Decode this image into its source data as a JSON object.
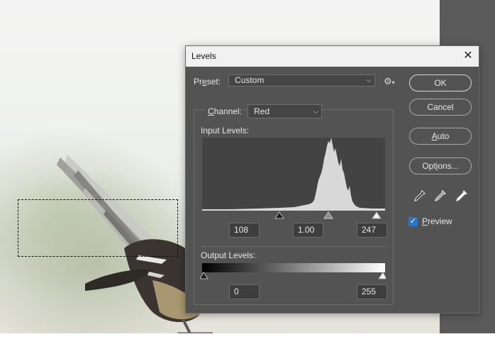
{
  "dialog": {
    "title": "Levels",
    "close_glyph": "✕",
    "preset_label_pre": "Pr",
    "preset_label_u": "e",
    "preset_label_post": "set:",
    "preset_value": "Custom",
    "channel_label_u": "C",
    "channel_label_post": "hannel:",
    "channel_value": "Red",
    "input_levels_label": "Input Levels:",
    "output_levels_label": "Output Levels:",
    "input_black": "108",
    "input_gamma": "1.00",
    "input_white": "247",
    "output_black": "0",
    "output_white": "255",
    "buttons": {
      "ok": "OK",
      "cancel": "Cancel",
      "auto_u": "A",
      "auto_post": "uto",
      "options_pre": "Opt",
      "options_u": "i",
      "options_post": "ons..."
    },
    "preview_u": "P",
    "preview_post": "review",
    "preview_checked": true,
    "check_glyph": "✓",
    "chevron_glyph": "⌵",
    "gear_glyph": "⚙"
  },
  "icons": {
    "close": "close-icon",
    "gear": "gear-icon",
    "eyedroppers": [
      "black-point-eyedropper-icon",
      "gray-point-eyedropper-icon",
      "white-point-eyedropper-icon"
    ]
  },
  "colors": {
    "dialog_bg": "#535353",
    "titlebar_bg": "#f0f0f0",
    "histogram_bg": "#434343",
    "histogram_fill": "#d8d8d8",
    "checkbox_accent": "#2c74c9"
  }
}
